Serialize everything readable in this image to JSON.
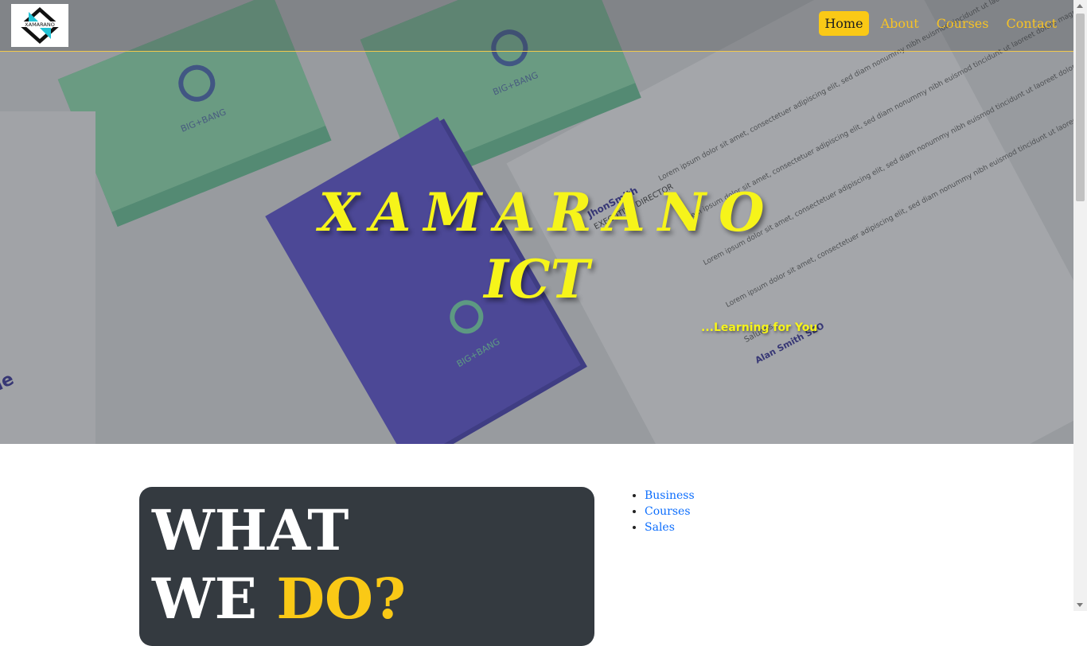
{
  "nav": {
    "logo_alt": "XAMARANO",
    "items": [
      {
        "label": "Home",
        "active": true
      },
      {
        "label": "About",
        "active": false
      },
      {
        "label": "Courses",
        "active": false
      },
      {
        "label": "Contact",
        "active": false
      }
    ]
  },
  "hero": {
    "title_line1": "XAMARANO",
    "title_line2": "ICT",
    "tagline": "...Learning for You",
    "background_name_1": "JhonSmith",
    "background_role": "EXECUTIVE DIRECTOR",
    "background_brand": "BIG+BANG",
    "background_name_2": "Alan Smith SEO",
    "background_salutation": "Saludos,",
    "background_lorem": "Lorem ipsum dolor sit amet, consectetuer adipiscing elit, sed diam nonummy nibh euismod tincidunt ut laoreet dolore magna aliquam erat volutpat.",
    "background_partial": "ie"
  },
  "what_we_do": {
    "line1": "WHAT",
    "line2_a": "WE ",
    "line2_b": "DO?"
  },
  "links": [
    "Business",
    "Courses",
    "Sales"
  ],
  "colors": {
    "accent": "#fac916",
    "title_yellow": "#f6f41a",
    "card_bg": "#343a40",
    "link_blue": "#0d6efd"
  }
}
